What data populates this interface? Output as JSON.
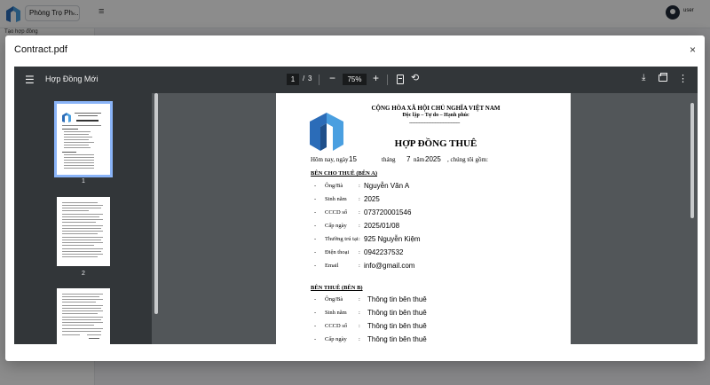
{
  "app": {
    "project_select": "Phòng Trọ Ph...",
    "sidebar_item": "Tạo hợp đồng",
    "user_label": "user"
  },
  "modal": {
    "title": "Contract.pdf",
    "close_icon": "×"
  },
  "viewer": {
    "doc_title": "Hợp Đồng Mới",
    "current_page": "1",
    "page_separator": "/",
    "total_pages": "3",
    "zoom": "75%",
    "thumbnail_labels": [
      "1",
      "2"
    ]
  },
  "document": {
    "national_title": "CỘNG HÒA XÃ HỘI CHỦ NGHĨA VIỆT NAM",
    "motto": "Độc lập – Tự do – Hạnh phúc",
    "dashes": "--------------------------------------",
    "contract_title": "HỢP ĐỒNG THUÊ",
    "date_prefix": "Hôm nay, ngày",
    "day": "15",
    "month_label": "tháng",
    "month": "7",
    "year_label": "năm",
    "year": "2025",
    "date_suffix": ", chúng tôi gồm:",
    "lessor_heading": "BÊN CHO THUÊ (BÊN A)",
    "lessor_rows": [
      {
        "label": "Ông/Bà",
        "value": "Nguyễn Văn A"
      },
      {
        "label": "Sinh năm",
        "value": "2025"
      },
      {
        "label": "CCCD số",
        "value": "073720001546"
      },
      {
        "label": "Cấp ngày",
        "value": "2025/01/08"
      },
      {
        "label": "Thường trú tại",
        "value": "925 Nguyễn Kiệm"
      },
      {
        "label": "Điện thoại",
        "value": "0942237532"
      },
      {
        "label": "Email",
        "value": "info@gmail.com"
      }
    ],
    "lessee_heading": "BÊN THUÊ (BÊN B)",
    "lessee_rows": [
      {
        "label": "Ông/Bà",
        "value": "Thông tin bên thuê"
      },
      {
        "label": "Sinh năm",
        "value": "Thông tin bên thuê"
      },
      {
        "label": "CCCD số",
        "value": "Thông tin bên thuê"
      },
      {
        "label": "Cấp ngày",
        "value": "Thông tin bên thuê"
      }
    ]
  },
  "colors": {
    "toolbar": "#323639",
    "viewer_bg": "#525659",
    "thumb_selected": "#8ab4f8",
    "logo_blue": "#2b6cb8",
    "logo_light": "#4a9fe0"
  },
  "icons": [
    "menu-icon",
    "minus-icon",
    "plus-icon",
    "fit-page-icon",
    "rotate-icon",
    "download-icon",
    "print-icon",
    "more-vert-icon",
    "close-icon"
  ]
}
